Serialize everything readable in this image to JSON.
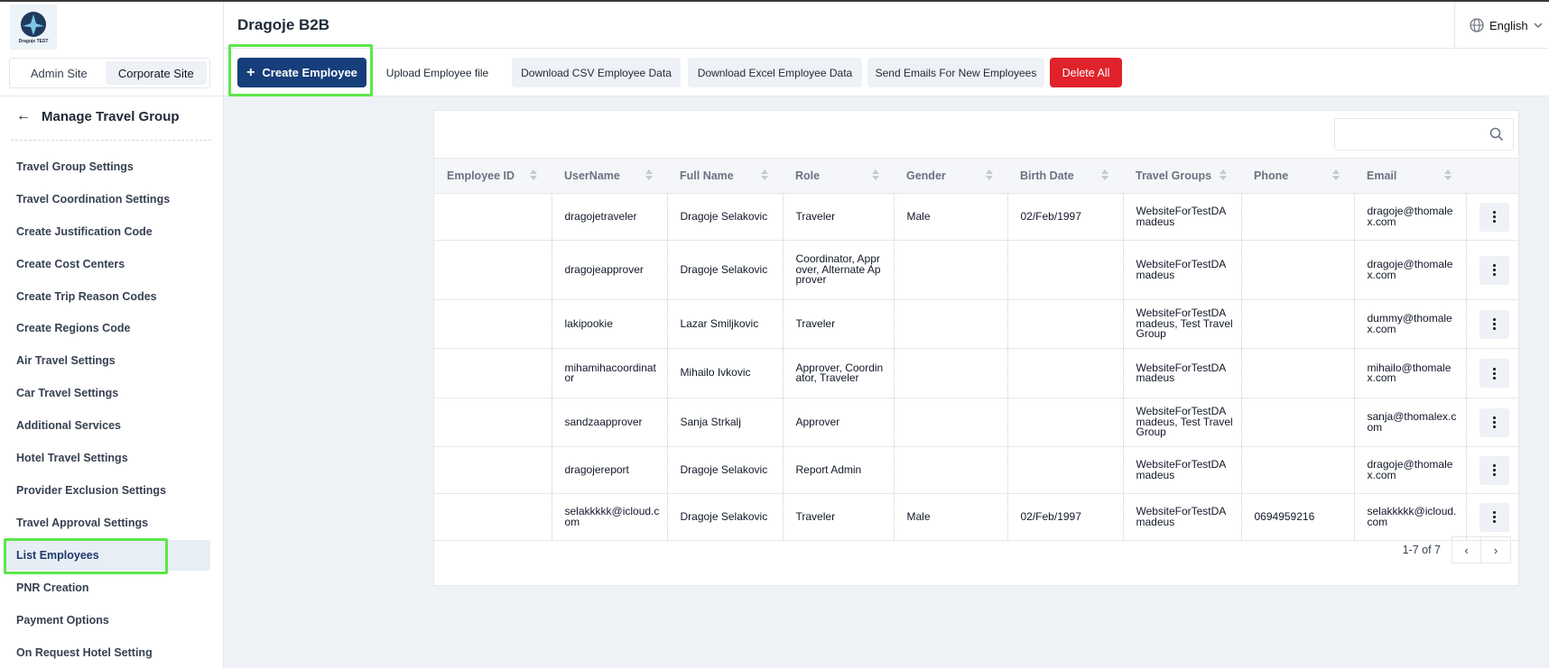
{
  "app": {
    "logo_text": "Dragoje TEST",
    "title": "Dragoje B2B",
    "language": "English"
  },
  "site_switch": {
    "admin": "Admin Site",
    "corporate": "Corporate Site"
  },
  "sidebar": {
    "back_title": "Manage Travel Group",
    "items": [
      {
        "label": "Travel Group Settings"
      },
      {
        "label": "Travel Coordination Settings"
      },
      {
        "label": "Create Justification Code"
      },
      {
        "label": "Create Cost Centers"
      },
      {
        "label": "Create Trip Reason Codes"
      },
      {
        "label": "Create Regions Code"
      },
      {
        "label": "Air Travel Settings"
      },
      {
        "label": "Car Travel Settings"
      },
      {
        "label": "Additional Services"
      },
      {
        "label": "Hotel Travel Settings"
      },
      {
        "label": "Provider Exclusion Settings"
      },
      {
        "label": "Travel Approval Settings"
      },
      {
        "label": "List Employees"
      },
      {
        "label": "PNR Creation"
      },
      {
        "label": "Payment Options"
      },
      {
        "label": "On Request Hotel Setting"
      }
    ],
    "active": "List Employees"
  },
  "toolbar": {
    "create": "Create Employee",
    "upload": "Upload Employee file",
    "download_csv": "Download CSV Employee Data",
    "download_excel": "Download Excel Employee Data",
    "send_emails": "Send Emails For New Employees",
    "delete_all": "Delete All"
  },
  "search": {
    "placeholder": ""
  },
  "table": {
    "columns": [
      "Employee ID",
      "UserName",
      "Full Name",
      "Role",
      "Gender",
      "Birth Date",
      "Travel Groups",
      "Phone",
      "Email"
    ],
    "rows": [
      {
        "employee_id": "",
        "username": "dragojetraveler",
        "full_name": "Dragoje Selakovic",
        "role": "Traveler",
        "gender": "Male",
        "birth_date": "02/Feb/1997",
        "travel_groups": "WebsiteForTestDAmadeus",
        "phone": "",
        "email": "dragoje@thomalex.com"
      },
      {
        "employee_id": "",
        "username": "dragojeapprover",
        "full_name": "Dragoje Selakovic",
        "role": "Coordinator, Approver, Alternate Approver",
        "gender": "",
        "birth_date": "",
        "travel_groups": "WebsiteForTestDAmadeus",
        "phone": "",
        "email": "dragoje@thomalex.com"
      },
      {
        "employee_id": "",
        "username": "lakipookie",
        "full_name": "Lazar Smiljkovic",
        "role": "Traveler",
        "gender": "",
        "birth_date": "",
        "travel_groups": "WebsiteForTestDAmadeus, Test Travel Group",
        "phone": "",
        "email": "dummy@thomalex.com"
      },
      {
        "employee_id": "",
        "username": "mihamihacoordinator",
        "full_name": "Mihailo Ivkovic",
        "role": "Approver, Coordinator, Traveler",
        "gender": "",
        "birth_date": "",
        "travel_groups": "WebsiteForTestDAmadeus",
        "phone": "",
        "email": "mihailo@thomalex.com"
      },
      {
        "employee_id": "",
        "username": "sandzaapprover",
        "full_name": "Sanja Strkalj",
        "role": "Approver",
        "gender": "",
        "birth_date": "",
        "travel_groups": "WebsiteForTestDAmadeus, Test Travel Group",
        "phone": "",
        "email": "sanja@thomalex.com"
      },
      {
        "employee_id": "",
        "username": "dragojereport",
        "full_name": "Dragoje Selakovic",
        "role": "Report Admin",
        "gender": "",
        "birth_date": "",
        "travel_groups": "WebsiteForTestDAmadeus",
        "phone": "",
        "email": "dragoje@thomalex.com"
      },
      {
        "employee_id": "",
        "username": "selakkkkk@icloud.com",
        "full_name": "Dragoje Selakovic",
        "role": "Traveler",
        "gender": "Male",
        "birth_date": "02/Feb/1997",
        "travel_groups": "WebsiteForTestDAmadeus",
        "phone": "0694959216",
        "email": "selakkkkk@icloud.com"
      }
    ]
  },
  "pagination": {
    "text": "1-7 of 7"
  },
  "colors": {
    "primary": "#163e7a",
    "danger": "#e0222a",
    "highlight": "#5ce64a"
  },
  "icons": [
    "globe-icon",
    "chevron-down-icon",
    "back-arrow-icon",
    "plus-icon",
    "search-icon",
    "sort-icon",
    "more-vertical-icon",
    "chevron-left-icon",
    "chevron-right-icon"
  ]
}
